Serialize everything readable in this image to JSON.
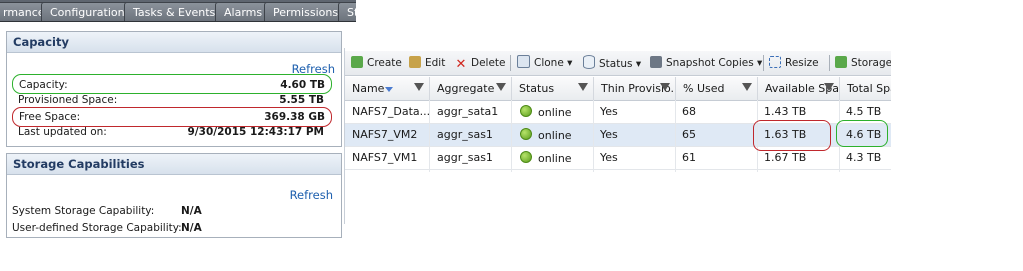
{
  "tabs": [
    "rmance",
    "Configuration",
    "Tasks & Events",
    "Alarms",
    "Permissions",
    "St"
  ],
  "capacity": {
    "title": "Capacity",
    "refresh": "Refresh",
    "rows": [
      {
        "label": "Capacity:",
        "value": "4.60 TB"
      },
      {
        "label": "Provisioned Space:",
        "value": "5.55 TB"
      },
      {
        "label": "Free Space:",
        "value": "369.38 GB"
      },
      {
        "label": "Last updated on:",
        "value": "9/30/2015 12:43:17 PM"
      }
    ]
  },
  "storage_capabilities": {
    "title": "Storage Capabilities",
    "refresh": "Refresh",
    "rows": [
      {
        "label": "System Storage Capability:",
        "value": "N/A"
      },
      {
        "label": "User-defined Storage Capability:",
        "value": "N/A"
      }
    ]
  },
  "toolbar": {
    "create": "Create",
    "edit": "Edit",
    "delete": "Delete",
    "clone": "Clone",
    "status": "Status",
    "snapshot": "Snapshot Copies",
    "resize": "Resize",
    "storage": "Storage"
  },
  "grid": {
    "columns": [
      "Name",
      "Aggregate",
      "Status",
      "Thin Provisio...",
      "% Used",
      "Available Spa...",
      "Total Spa"
    ],
    "rows": [
      {
        "name": "NAFS7_Data...",
        "aggregate": "aggr_sata1",
        "status": "online",
        "thin": "Yes",
        "used": "68",
        "available": "1.43 TB",
        "total": "4.5 TB"
      },
      {
        "name": "NAFS7_VM2",
        "aggregate": "aggr_sas1",
        "status": "online",
        "thin": "Yes",
        "used": "65",
        "available": "1.63 TB",
        "total": "4.6 TB"
      },
      {
        "name": "NAFS7_VM1",
        "aggregate": "aggr_sas1",
        "status": "online",
        "thin": "Yes",
        "used": "61",
        "available": "1.67 TB",
        "total": "4.3 TB"
      }
    ]
  },
  "colors": {
    "annotation_red": "#c0282d",
    "annotation_green": "#2db12d",
    "online": "#5b9d1c"
  }
}
